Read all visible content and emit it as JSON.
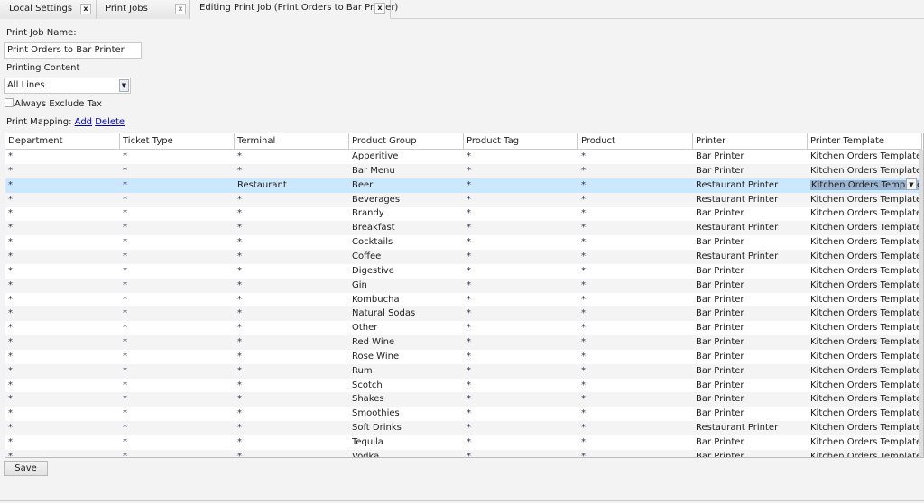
{
  "tabs": [
    {
      "label": "Local Settings"
    },
    {
      "label": "Print Jobs"
    },
    {
      "label": "Editing Print Job (Print Orders to Bar Printer)"
    }
  ],
  "close_glyph": "x",
  "form": {
    "name_label": "Print Job Name:",
    "name_value": "Print Orders to Bar Printer",
    "content_label": "Printing Content",
    "content_value": "All Lines",
    "exclude_tax_label": "Always Exclude Tax",
    "mapping_label": "Print Mapping:",
    "add_link": "Add",
    "delete_link": "Delete"
  },
  "grid": {
    "columns": [
      "Department",
      "Ticket Type",
      "Terminal",
      "Product Group",
      "Product Tag",
      "Product",
      "Printer",
      "Printer Template"
    ],
    "selected_row": 2,
    "rows": [
      [
        "*",
        "*",
        "*",
        "Apperitive",
        "*",
        "*",
        "Bar Printer",
        "Kitchen Orders Template"
      ],
      [
        "*",
        "*",
        "*",
        "Bar Menu",
        "*",
        "*",
        "Bar Printer",
        "Kitchen Orders Template"
      ],
      [
        "*",
        "*",
        "Restaurant",
        "Beer",
        "*",
        "*",
        "Restaurant Printer",
        "Kitchen Orders Template"
      ],
      [
        "*",
        "*",
        "*",
        "Beverages",
        "*",
        "*",
        "Restaurant Printer",
        "Kitchen Orders Template"
      ],
      [
        "*",
        "*",
        "*",
        "Brandy",
        "*",
        "*",
        "Bar Printer",
        "Kitchen Orders Template"
      ],
      [
        "*",
        "*",
        "*",
        "Breakfast",
        "*",
        "*",
        "Restaurant Printer",
        "Kitchen Orders Template"
      ],
      [
        "*",
        "*",
        "*",
        "Cocktails",
        "*",
        "*",
        "Bar Printer",
        "Kitchen Orders Template"
      ],
      [
        "*",
        "*",
        "*",
        "Coffee",
        "*",
        "*",
        "Restaurant Printer",
        "Kitchen Orders Template"
      ],
      [
        "*",
        "*",
        "*",
        "Digestive",
        "*",
        "*",
        "Bar Printer",
        "Kitchen Orders Template"
      ],
      [
        "*",
        "*",
        "*",
        "Gin",
        "*",
        "*",
        "Bar Printer",
        "Kitchen Orders Template"
      ],
      [
        "*",
        "*",
        "*",
        "Kombucha",
        "*",
        "*",
        "Bar Printer",
        "Kitchen Orders Template"
      ],
      [
        "*",
        "*",
        "*",
        "Natural Sodas",
        "*",
        "*",
        "Bar Printer",
        "Kitchen Orders Template"
      ],
      [
        "*",
        "*",
        "*",
        "Other",
        "*",
        "*",
        "Bar Printer",
        "Kitchen Orders Template"
      ],
      [
        "*",
        "*",
        "*",
        "Red Wine",
        "*",
        "*",
        "Bar Printer",
        "Kitchen Orders Template"
      ],
      [
        "*",
        "*",
        "*",
        "Rose Wine",
        "*",
        "*",
        "Bar Printer",
        "Kitchen Orders Template"
      ],
      [
        "*",
        "*",
        "*",
        "Rum",
        "*",
        "*",
        "Bar Printer",
        "Kitchen Orders Template"
      ],
      [
        "*",
        "*",
        "*",
        "Scotch",
        "*",
        "*",
        "Bar Printer",
        "Kitchen Orders Template"
      ],
      [
        "*",
        "*",
        "*",
        "Shakes",
        "*",
        "*",
        "Bar Printer",
        "Kitchen Orders Template"
      ],
      [
        "*",
        "*",
        "*",
        "Smoothies",
        "*",
        "*",
        "Bar Printer",
        "Kitchen Orders Template"
      ],
      [
        "*",
        "*",
        "*",
        "Soft Drinks",
        "*",
        "*",
        "Restaurant Printer",
        "Kitchen Orders Template"
      ],
      [
        "*",
        "*",
        "*",
        "Tequila",
        "*",
        "*",
        "Bar Printer",
        "Kitchen Orders Template"
      ],
      [
        "*",
        "*",
        "*",
        "Vodka",
        "*",
        "*",
        "Bar Printer",
        "Kitchen Orders Template"
      ]
    ]
  },
  "save_label": "Save"
}
